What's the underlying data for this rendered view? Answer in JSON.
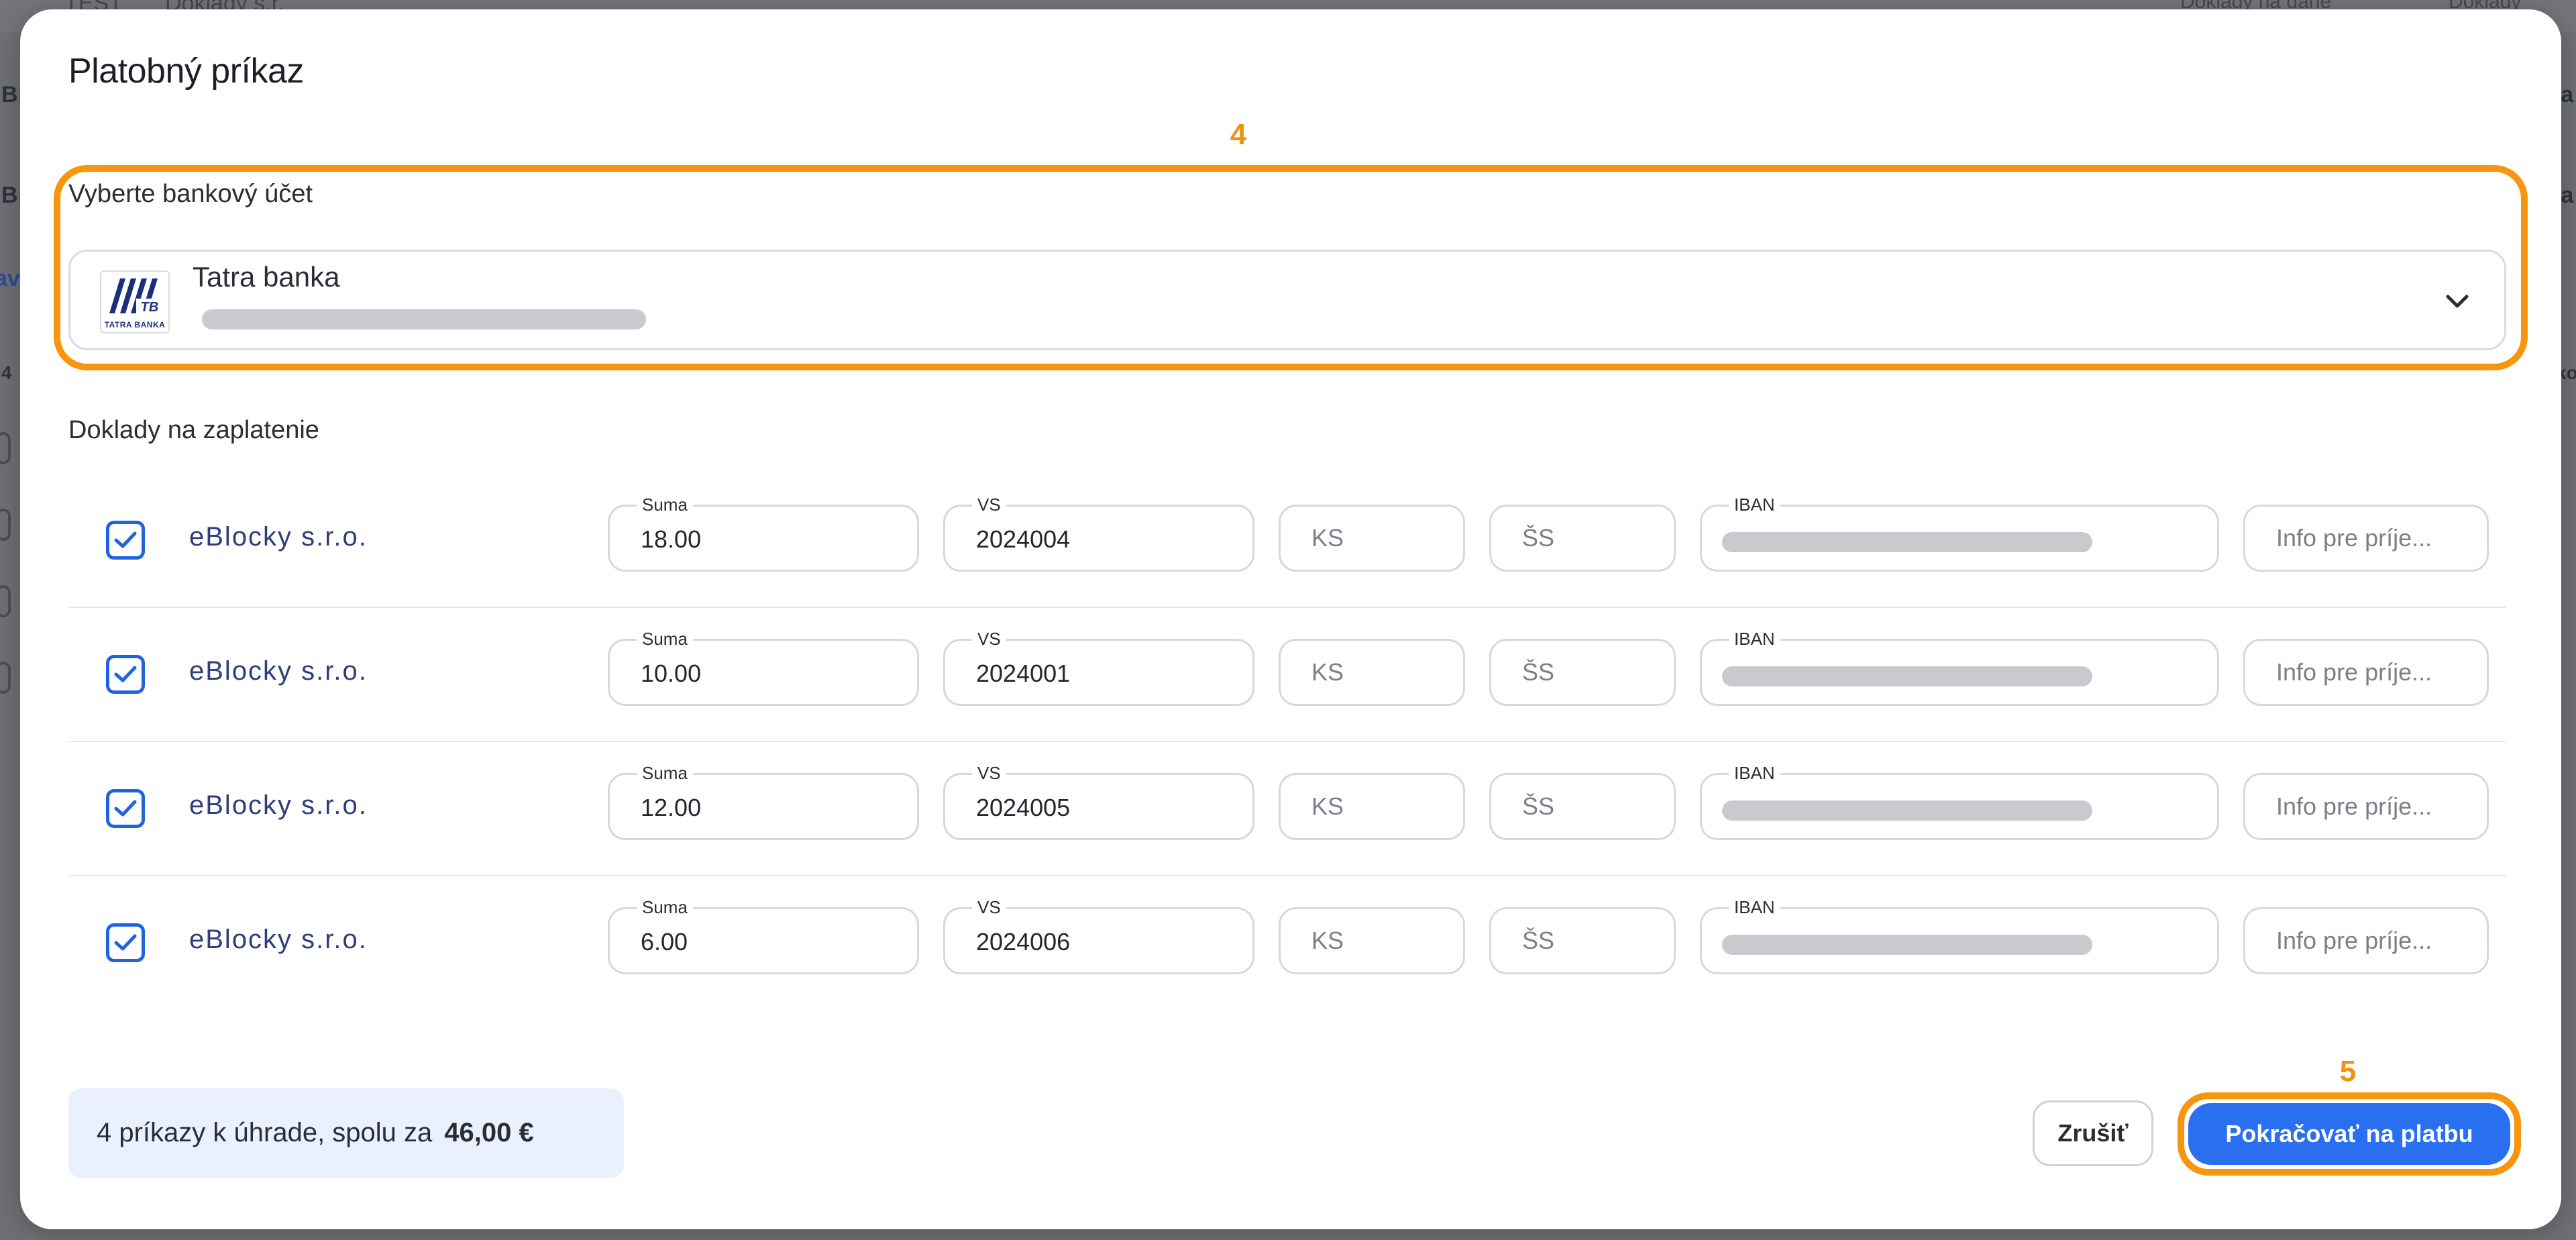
{
  "background": {
    "title_prefix": "TEST",
    "title_doc": "Doklady s.r.",
    "right_text_1": "Doklady na dane",
    "right_text_2": "Doklady",
    "edge_letters_left": [
      "B",
      "B",
      "av",
      "4"
    ],
    "edge_letters_right": [
      "ta",
      "ta",
      "ko"
    ]
  },
  "modal": {
    "title": "Platobný príkaz"
  },
  "steps": {
    "step_4": "4",
    "step_5": "5"
  },
  "bank_account": {
    "label": "Vyberte bankový účet",
    "bank_name": "Tatra banka",
    "logo_text": "TATRA BANKA",
    "logo_monogram": "TB"
  },
  "documents": {
    "label": "Doklady na zaplatenie",
    "field_labels": {
      "amount": "Suma",
      "vs": "VS",
      "iban": "IBAN"
    },
    "placeholders": {
      "ks": "KS",
      "ss": "ŠS",
      "info": "Info pre príje..."
    },
    "rows": [
      {
        "payee": "eBlocky s.r.o.",
        "amount": "18.00",
        "vs": "2024004",
        "checked": true
      },
      {
        "payee": "eBlocky s.r.o.",
        "amount": "10.00",
        "vs": "2024001",
        "checked": true
      },
      {
        "payee": "eBlocky s.r.o.",
        "amount": "12.00",
        "vs": "2024005",
        "checked": true
      },
      {
        "payee": "eBlocky s.r.o.",
        "amount": "6.00",
        "vs": "2024006",
        "checked": true
      }
    ]
  },
  "footer": {
    "summary_text": "4 príkazy k úhrade, spolu za",
    "summary_total": "46,00 €",
    "cancel_label": "Zrušiť",
    "continue_label": "Pokračovať na platbu"
  },
  "colors": {
    "accent_blue": "#2a6ff0",
    "highlight_orange": "#f7950f",
    "checkbox_blue": "#1f63df",
    "summary_bg": "#eaf1fd"
  }
}
